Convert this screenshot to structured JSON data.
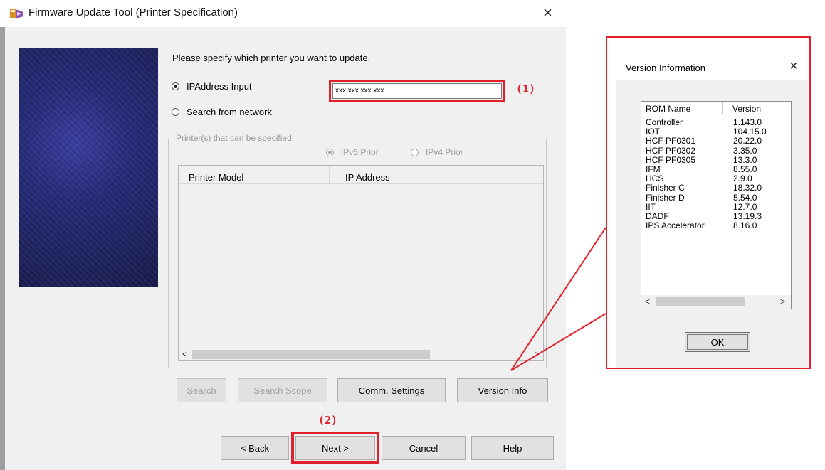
{
  "main_window": {
    "title": "Firmware Update Tool (Printer Specification)",
    "close_glyph": "×",
    "prompt": "Please specify which printer you want to update.",
    "options": {
      "ip_address_input_label": "IPAddress Input",
      "search_network_label": "Search from network",
      "selected": "IPAddress Input"
    },
    "ip_value": "xxx.xxx.xxx.xxx",
    "group_title": "Printer(s) that can be specified:",
    "ipv6_label": "IPv6 Prior",
    "ipv4_label": "IPv4 Prior",
    "ip_priority_selected": "IPv6 Prior",
    "table_headers": [
      "Printer Model",
      "IP Address"
    ],
    "table_rows": [],
    "buttons": {
      "search": "Search",
      "search_scope": "Search Scope",
      "comm_settings": "Comm. Settings",
      "version_info": "Version Info",
      "back": "< Back",
      "next": "Next >",
      "cancel": "Cancel",
      "help": "Help"
    }
  },
  "annotations": {
    "callout_1": "(1)",
    "callout_2": "(2)",
    "highlight_color": "#e0202a"
  },
  "version_dialog": {
    "title": "Version Information",
    "close_glyph": "×",
    "headers": [
      "ROM Name",
      "Version"
    ],
    "rows": [
      {
        "name": "Controller",
        "version": "1.143.0"
      },
      {
        "name": "IOT",
        "version": "104.15.0"
      },
      {
        "name": "HCF PF0301",
        "version": "20.22.0"
      },
      {
        "name": "HCF PF0302",
        "version": "3.35.0"
      },
      {
        "name": "HCF PF0305",
        "version": "13.3.0"
      },
      {
        "name": "IFM",
        "version": "8.55.0"
      },
      {
        "name": "HCS",
        "version": "2.9.0"
      },
      {
        "name": "Finisher C",
        "version": "18.32.0"
      },
      {
        "name": "Finisher D",
        "version": "5.54.0"
      },
      {
        "name": "IIT",
        "version": "12.7.0"
      },
      {
        "name": "DADF",
        "version": "13.19.3"
      },
      {
        "name": "IPS Accelerator",
        "version": "8.16.0"
      }
    ],
    "ok_label": "OK"
  },
  "scroll_arrows": {
    "left": "<",
    "right": ">"
  }
}
